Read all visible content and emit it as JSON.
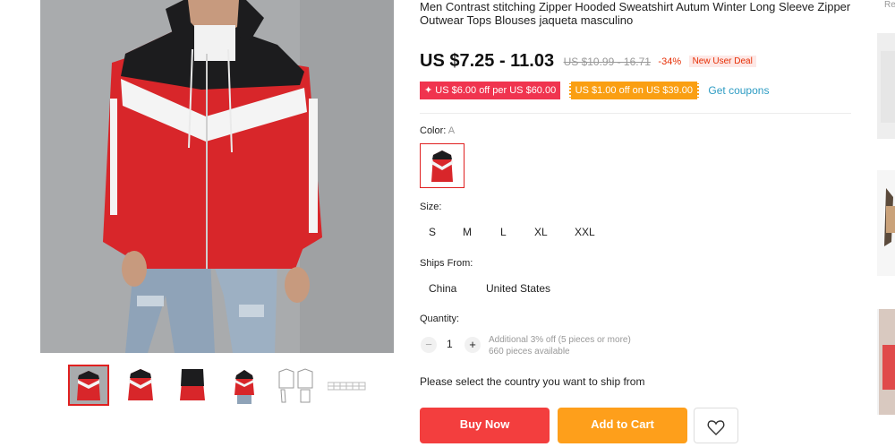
{
  "product": {
    "title": "Men Contrast stitching Zipper Hooded Sweatshirt Autum Winter Long Sleeve Zipper Outwear Tops Blouses jaqueta masculino",
    "price": "US $7.25 - 11.03",
    "original_price": "US $10.99 - 16.71",
    "discount": "-34%",
    "deal_badge": "New User Deal"
  },
  "coupons": {
    "coupon_1": "✦ US $6.00 off per US $60.00",
    "coupon_2": "US $1.00 off on US $39.00",
    "get_coupons": "Get coupons"
  },
  "color": {
    "label": "Color:",
    "selected": "A"
  },
  "size": {
    "label": "Size:",
    "options": [
      "S",
      "M",
      "L",
      "XL",
      "XXL"
    ]
  },
  "ships_from": {
    "label": "Ships From:",
    "options": [
      "China",
      "United States"
    ]
  },
  "quantity": {
    "label": "Quantity:",
    "value": "1",
    "minus": "−",
    "plus": "+",
    "additional": "Additional 3% off (5 pieces or more)",
    "available": "660 pieces available"
  },
  "ship_notice": "Please select the country you want to ship from",
  "actions": {
    "buy_now": "Buy Now",
    "add_to_cart": "Add to Cart"
  },
  "recommendations": {
    "label": "Re"
  },
  "colors": {
    "accent_red": "#f33e3e",
    "accent_orange": "#fe9f1b",
    "link_blue": "#2e9cc3"
  }
}
